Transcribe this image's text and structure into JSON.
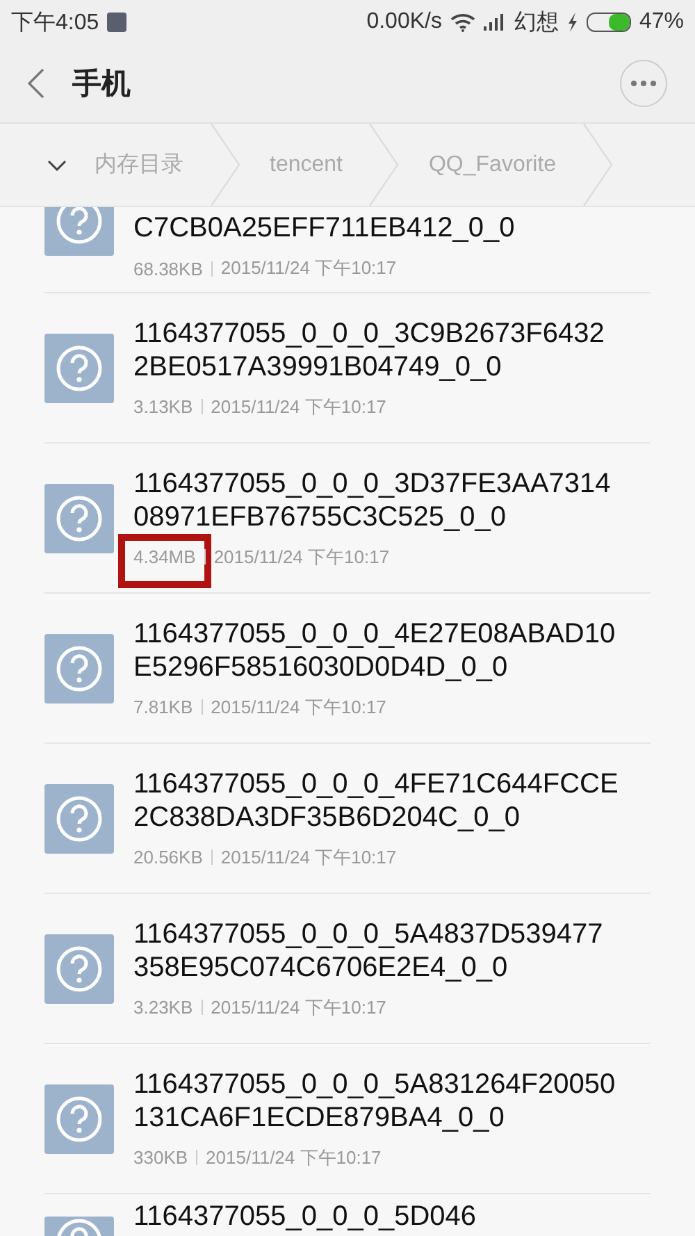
{
  "status_bar": {
    "time": "下午4:05",
    "speed": "0.00K/s",
    "carrier": "幻想",
    "battery": "47%"
  },
  "header": {
    "title": "手机"
  },
  "breadcrumb": [
    "内存目录",
    "tencent",
    "QQ_Favorite"
  ],
  "files": [
    {
      "title_lines": [
        "C7CB0A25EFF711EB412_0_0"
      ],
      "size": "68.38KB",
      "date": "2015/11/24 下午10:17",
      "highlighted": false
    },
    {
      "title_lines": [
        "1164377055_0_0_0_3C9B2673F6432",
        "2BE0517A39991B04749_0_0"
      ],
      "size": "3.13KB",
      "date": "2015/11/24 下午10:17",
      "highlighted": false
    },
    {
      "title_lines": [
        "1164377055_0_0_0_3D37FE3AA7314",
        "08971EFB76755C3C525_0_0"
      ],
      "size": "4.34MB",
      "date": "2015/11/24 下午10:17",
      "highlighted": true
    },
    {
      "title_lines": [
        "1164377055_0_0_0_4E27E08ABAD10",
        "E5296F58516030D0D4D_0_0"
      ],
      "size": "7.81KB",
      "date": "2015/11/24 下午10:17",
      "highlighted": false
    },
    {
      "title_lines": [
        "1164377055_0_0_0_4FE71C644FCCE",
        "2C838DA3DF35B6D204C_0_0"
      ],
      "size": "20.56KB",
      "date": "2015/11/24 下午10:17",
      "highlighted": false
    },
    {
      "title_lines": [
        "1164377055_0_0_0_5A4837D539477",
        "358E95C074C6706E2E4_0_0"
      ],
      "size": "3.23KB",
      "date": "2015/11/24 下午10:17",
      "highlighted": false
    },
    {
      "title_lines": [
        "1164377055_0_0_0_5A831264F20050",
        "131CA6F1ECDE879BA4_0_0"
      ],
      "size": "330KB",
      "date": "2015/11/24 下午10:17",
      "highlighted": false
    },
    {
      "title_lines": [
        "1164377055_0_0_0_5D046"
      ]
    }
  ]
}
